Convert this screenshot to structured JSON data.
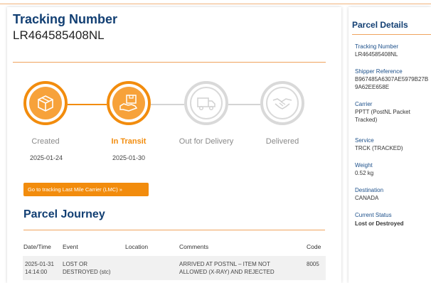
{
  "header": {
    "title": "Tracking Number",
    "tracking_number": "LR464585408NL"
  },
  "steps": [
    {
      "label": "Created",
      "date": "2025-01-24",
      "state": "done",
      "icon": "package-box-icon"
    },
    {
      "label": "In Transit",
      "date": "2025-01-30",
      "state": "active",
      "icon": "hand-package-icon"
    },
    {
      "label": "Out for Delivery",
      "date": "",
      "state": "pending",
      "icon": "delivery-truck-icon"
    },
    {
      "label": "Delivered",
      "date": "",
      "state": "pending",
      "icon": "handshake-icon"
    }
  ],
  "lmc_button": "Go to tracking Last Mile Carrier (LMC) »",
  "journey": {
    "title": "Parcel Journey",
    "columns": [
      "Date/Time",
      "Event",
      "Location",
      "Comments",
      "Code"
    ],
    "rows": [
      {
        "date": "2025-01-31",
        "time": "14:14:00",
        "event_line1": "LOST OR",
        "event_line2": "DESTROYED (stc)",
        "location": "",
        "comment_line1": "ARRIVED AT POSTNL – ITEM NOT",
        "comment_line2": "ALLOWED (X-RAY) AND REJECTED",
        "code": "8005"
      }
    ]
  },
  "details": {
    "title": "Parcel Details",
    "tracking_label": "Tracking Number",
    "tracking_value": "LR464585408NL",
    "shipper_label": "Shipper Reference",
    "shipper_value_line1": "B967485A6307AE5979B27B",
    "shipper_value_line2": "9A62EE658E",
    "carrier_label": "Carrier",
    "carrier_value_line1": "PPTT (PostNL Packet",
    "carrier_value_line2": "Tracked)",
    "service_label": "Service",
    "service_value": "TRCK (TRACKED)",
    "weight_label": "Weight",
    "weight_value": "0.52 kg",
    "destination_label": "Destination",
    "destination_value": "CANADA",
    "status_label": "Current Status",
    "status_value": "Lost or Destroyed"
  },
  "colors": {
    "accent": "#f28c0d",
    "heading": "#123f73",
    "inactive": "#d9d9d9"
  }
}
